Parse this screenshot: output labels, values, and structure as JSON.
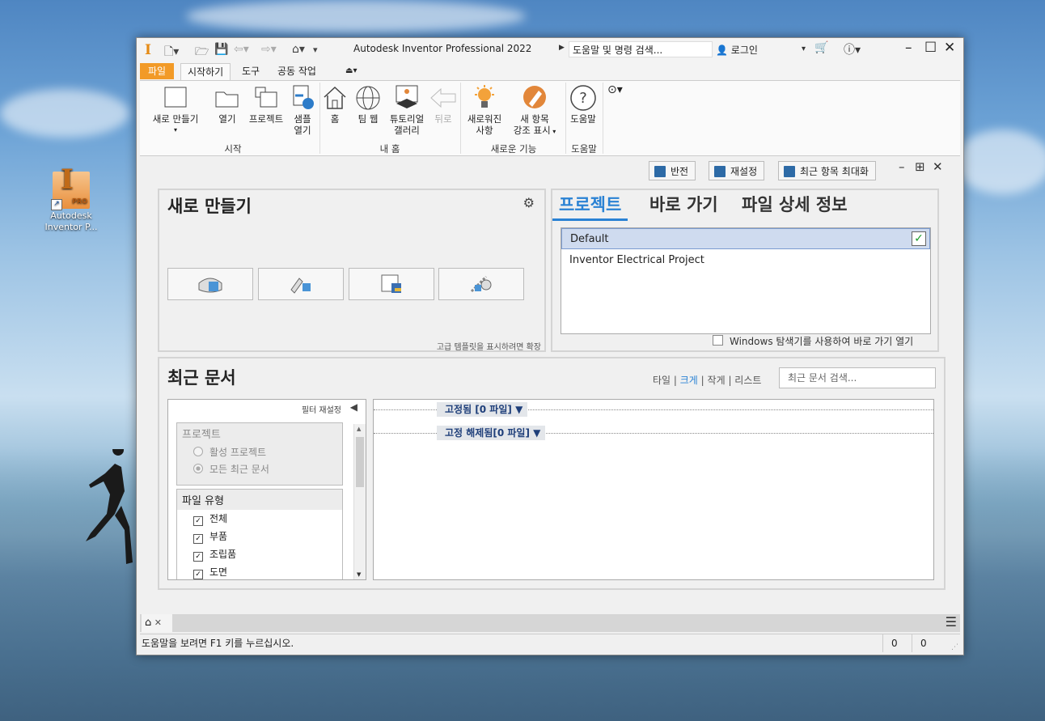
{
  "desktop": {
    "icon_label_1": "Autodesk",
    "icon_label_2": "Inventor P...",
    "icon_badge": "PRO"
  },
  "titlebar": {
    "title": "Autodesk Inventor Professional 2022",
    "search_placeholder": "도움말 및 명령 검색...",
    "login": "로그인"
  },
  "tabs": [
    "파일",
    "시작하기",
    "도구",
    "공동 작업"
  ],
  "ribbon": {
    "start": {
      "new": "새로 만들기",
      "open": "열기",
      "projects": "프로젝트",
      "samples_1": "샘플",
      "samples_2": "열기",
      "label": "시작"
    },
    "myhome": {
      "home": "홈",
      "team_web": "팀 웹",
      "tutorial_1": "튜토리얼",
      "tutorial_2": "갤러리",
      "back": "뒤로",
      "label": "내 홈"
    },
    "whatsnew": {
      "new_1": "새로워진",
      "new_2": "사항",
      "highlight_1": "새 항목",
      "highlight_2": "강조 표시",
      "label": "새로운 기능"
    },
    "help": {
      "help": "도움말",
      "label": "도움말"
    }
  },
  "toolbar": {
    "invert": "반전",
    "reset": "재설정",
    "maximize_recent": "최근 항목 최대화"
  },
  "new_panel": {
    "title": "새로 만들기",
    "hint": "고급 템플릿을 표시하려면 확장"
  },
  "projects_panel": {
    "tabs": [
      "프로젝트",
      "바로 가기",
      "파일 상세 정보"
    ],
    "items": [
      "Default",
      "Inventor Electrical Project"
    ],
    "explorer_option": "Windows 탐색기를 사용하여 바로 가기 열기"
  },
  "recent": {
    "title": "최근 문서",
    "views": [
      "타일",
      "크게",
      "작게",
      "리스트"
    ],
    "active_view": "크게",
    "search_placeholder": "최근 문서 검색...",
    "filter_reset": "필터 재설정",
    "project_group": "프로젝트",
    "project_options": [
      "활성 프로젝트",
      "모든 최근 문서"
    ],
    "filetype_group": "파일 유형",
    "filetypes": [
      "전체",
      "부품",
      "조립품",
      "도면"
    ],
    "pinned": "고정됨 [0 파일]",
    "unpinned": "고정 해제됨[0 파일]"
  },
  "status": {
    "text": "도움말을 보려면 F1 키를 누르십시오.",
    "count_1": "0",
    "count_2": "0"
  },
  "colors": {
    "accent": "#2a82d4",
    "file_tab": "#f29a27"
  }
}
